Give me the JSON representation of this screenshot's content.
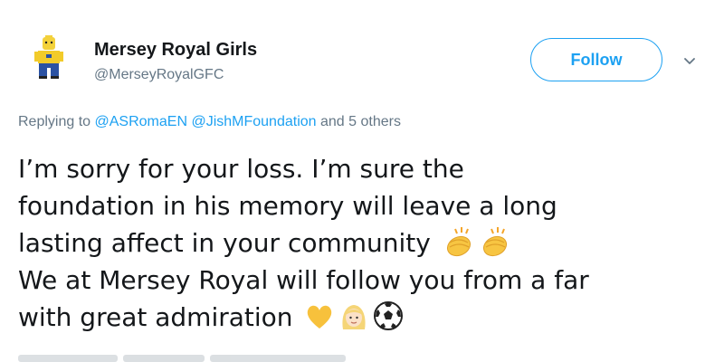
{
  "user": {
    "display_name": "Mersey Royal Girls",
    "handle": "@MerseyRoyalGFC",
    "avatar_icon": "lego-minifigure-avatar"
  },
  "follow": {
    "label": "Follow",
    "menu_icon": "chevron-down-icon"
  },
  "reply": {
    "prefix": "Replying to",
    "mentions": [
      "@ASRomaEN",
      "@JishMFoundation"
    ],
    "suffix": "and 5 others"
  },
  "tweet": {
    "line1": "I’m sorry for your loss. I’m sure the",
    "line2": "foundation in his memory will leave a long",
    "line3": "lasting affect in your community",
    "line4": "We at Mersey Royal will follow you from a far",
    "line5": "with great admiration",
    "emoji_line3": [
      "clapping-hands-emoji",
      "clapping-hands-emoji"
    ],
    "emoji_line5": [
      "yellow-heart-emoji",
      "blonde-woman-emoji",
      "soccer-ball-emoji"
    ]
  },
  "colors": {
    "accent": "#1da1f2",
    "secondary_text": "#657786",
    "primary_text": "#14171a"
  }
}
